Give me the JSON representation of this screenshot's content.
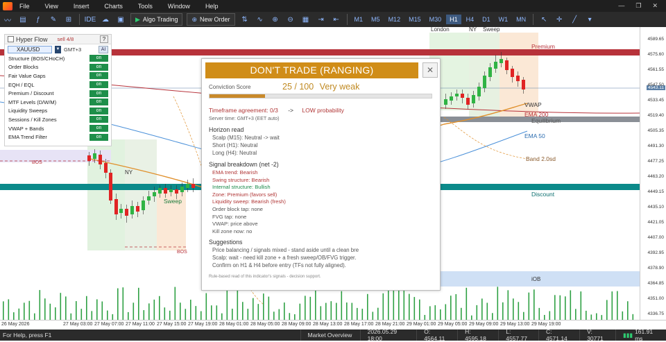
{
  "menu": {
    "items": [
      "File",
      "View",
      "Insert",
      "Charts",
      "Tools",
      "Window",
      "Help"
    ]
  },
  "toolbar": {
    "algo_trading": "Algo Trading",
    "new_order": "New Order",
    "ide_label": "IDE",
    "timeframes": [
      "M1",
      "M5",
      "M12",
      "M15",
      "M30",
      "H1",
      "H4",
      "D1",
      "W1",
      "MN"
    ],
    "active_timeframe": "H1"
  },
  "panel": {
    "title": "Hyper Flow",
    "status": "sell 4/8",
    "help": "?",
    "symbol": "XAUUSD",
    "timezone": "GMT+3",
    "ai": "AI",
    "rows": [
      {
        "label": "Structure (BOS/CHoCH)",
        "state": "on"
      },
      {
        "label": "Order Blocks",
        "state": "on"
      },
      {
        "label": "Fair Value Gaps",
        "state": "on"
      },
      {
        "label": "EQH / EQL",
        "state": "on"
      },
      {
        "label": "Premium / Discount",
        "state": "on"
      },
      {
        "label": "MTF Levels (D/W/M)",
        "state": "on"
      },
      {
        "label": "Liquidity Sweeps",
        "state": "on"
      },
      {
        "label": "Sessions / Kill Zones",
        "state": "on"
      },
      {
        "label": "VWAP + Bands",
        "state": "on"
      },
      {
        "label": "EMA Trend Filter",
        "state": "on"
      }
    ]
  },
  "overlay": {
    "banner": "DON'T TRADE (RANGING)",
    "close": "✕",
    "conviction_label": "Conviction Score",
    "score": "25 / 100",
    "score_text": "Very weak",
    "score_fraction": 0.25,
    "tf_agreement": "Timeframe agreement: 0/3",
    "tf_arrow": "->",
    "tf_result": "LOW probability",
    "server_time": "Server time: GMT+3  (EET auto)",
    "horizon_title": "Horizon read",
    "horizon": [
      "Scalp (M15):  Neutral   -> wait",
      "Short (H1):  Neutral",
      "Long (H4):  Neutral"
    ],
    "breakdown_title": "Signal breakdown   (net -2)",
    "breakdown": [
      {
        "text": "EMA trend: Bearish",
        "tone": "bear"
      },
      {
        "text": "Swing structure: Bearish",
        "tone": "bear"
      },
      {
        "text": "Internal structure: Bullish",
        "tone": "bull"
      },
      {
        "text": "Zone: Premium (favors sell)",
        "tone": "bear"
      },
      {
        "text": "Liquidity sweep: Bearish (fresh)",
        "tone": "bear"
      },
      {
        "text": "Order block tap: none",
        "tone": "muted"
      },
      {
        "text": "FVG tap: none",
        "tone": "muted"
      },
      {
        "text": "VWAP: price above",
        "tone": "muted"
      },
      {
        "text": "Kill zone now: no",
        "tone": "muted"
      }
    ],
    "suggestions_title": "Suggestions",
    "suggestions": [
      "Price balancing / signals mixed - stand aside until a clean bre",
      "Scalp: wait - need kill zone + a fresh sweep/OB/FVG trigger.",
      "Confirm on H1 & H4 before entry (TFs not fully aligned)."
    ],
    "footer": "Rule-based read of this indicator's signals - decision support."
  },
  "chart_labels": {
    "london": "London",
    "ny_top": "NY",
    "sweep_top": "Sweep",
    "premium": "Premium",
    "vwap": "VWAP",
    "ema200": "EMA 200",
    "equilibrium": "Equilibrium",
    "ema50": "EMA 50",
    "band": "Band 2.0sd",
    "discount": "Discount",
    "iob": "iOB",
    "bos_left": "BOS",
    "bos_bottom": "BOS",
    "ny_left": "NY",
    "sweep_left": "Sweep",
    "price_tag": "4543.11"
  },
  "price_scale": [
    "4589.65",
    "4575.60",
    "4561.55",
    "4547.50",
    "4533.45",
    "4519.40",
    "4505.35",
    "4491.30",
    "4477.25",
    "4463.20",
    "4449.15",
    "4435.10",
    "4421.05",
    "4407.00",
    "4392.95",
    "4378.90",
    "4364.85",
    "4351.00",
    "4336.75"
  ],
  "time_axis": [
    "26 May 2026",
    "27 May 03:00",
    "27 May 07:00",
    "27 May 11:00",
    "27 May 15:00",
    "27 May 19:00",
    "28 May 01:00",
    "28 May 05:00",
    "28 May 09:00",
    "28 May 13:00",
    "28 May 17:00",
    "28 May 21:00",
    "29 May 01:00",
    "29 May 05:00",
    "29 May 09:00",
    "29 May 13:00",
    "29 May 19:00"
  ],
  "status": {
    "help": "For Help, press F1",
    "market": "Market Overview",
    "datetime": "2026.05.29 18:00",
    "open": "O: 4564.11",
    "high": "H: 4595.18",
    "low": "L: 4557.77",
    "close": "C: 4571.14",
    "volume": "V: 30771",
    "kb": "161.91 ms"
  },
  "colors": {
    "banner": "#d08d18",
    "toggle_on": "#1e8f4a",
    "premium_band": "#b7323a",
    "equilibrium_band": "#8a8f96",
    "discount_band": "#0b8a8a",
    "iob_zone": "#cfe0f5"
  }
}
